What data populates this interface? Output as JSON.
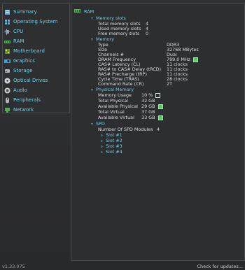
{
  "sidebar": {
    "items": [
      {
        "label": "Summary",
        "icon": "summary-icon",
        "color": "#6fa8dc"
      },
      {
        "label": "Operating System",
        "icon": "windows-icon",
        "color": "#4fb3e6"
      },
      {
        "label": "CPU",
        "icon": "cpu-icon",
        "color": "#8aa0b8"
      },
      {
        "label": "RAM",
        "icon": "ram-icon",
        "color": "#4caf50"
      },
      {
        "label": "Motherboard",
        "icon": "motherboard-icon",
        "color": "#6b8e23"
      },
      {
        "label": "Graphics",
        "icon": "graphics-icon",
        "color": "#3aa0d8"
      },
      {
        "label": "Storage",
        "icon": "storage-icon",
        "color": "#aab2bd"
      },
      {
        "label": "Optical Drives",
        "icon": "disc-icon",
        "color": "#cfd4da"
      },
      {
        "label": "Audio",
        "icon": "audio-icon",
        "color": "#d0d0d0"
      },
      {
        "label": "Peripherals",
        "icon": "peripherals-icon",
        "color": "#b0b6bd"
      },
      {
        "label": "Network",
        "icon": "network-icon",
        "color": "#4caf50"
      }
    ]
  },
  "panel": {
    "title": "RAM",
    "memory_slots": {
      "heading": "Memory slots",
      "rows": [
        {
          "label": "Total memory slots",
          "value": "4"
        },
        {
          "label": "Used memory slots",
          "value": "4"
        },
        {
          "label": "Free memory slots",
          "value": "0"
        }
      ]
    },
    "memory": {
      "heading": "Memory",
      "rows": [
        {
          "label": "Type",
          "value": "DDR3"
        },
        {
          "label": "Size",
          "value": "32768 MBytes"
        },
        {
          "label": "Channels #",
          "value": "Dual"
        },
        {
          "label": "DRAM Frequency",
          "value": "799.0 MHz"
        },
        {
          "label": "CAS# Latency (CL)",
          "value": "11 clocks"
        },
        {
          "label": "RAS# to CAS# Delay (tRCD)",
          "value": "11 clocks"
        },
        {
          "label": "RAS# Precharge (tRP)",
          "value": "11 clocks"
        },
        {
          "label": "Cycle Time (TRAS)",
          "value": "28 clocks"
        },
        {
          "label": "Command Rate (CR)",
          "value": "2T"
        }
      ]
    },
    "physical_memory": {
      "heading": "Physical Memory",
      "rows": [
        {
          "label": "Memory Usage",
          "value": "10 %"
        },
        {
          "label": "Total Physical",
          "value": "32 GB"
        },
        {
          "label": "Available Physical",
          "value": "29 GB"
        },
        {
          "label": "Total Virtual",
          "value": "37 GB"
        },
        {
          "label": "Available Virtual",
          "value": "33 GB"
        }
      ]
    },
    "spd": {
      "heading": "SPD",
      "modules_label": "Number Of SPD Modules",
      "modules_value": "4",
      "slots": [
        "Slot #1",
        "Slot #2",
        "Slot #3",
        "Slot #4"
      ]
    }
  },
  "footer": {
    "version": "v1.33.075",
    "check_updates": "Check for updates..."
  }
}
